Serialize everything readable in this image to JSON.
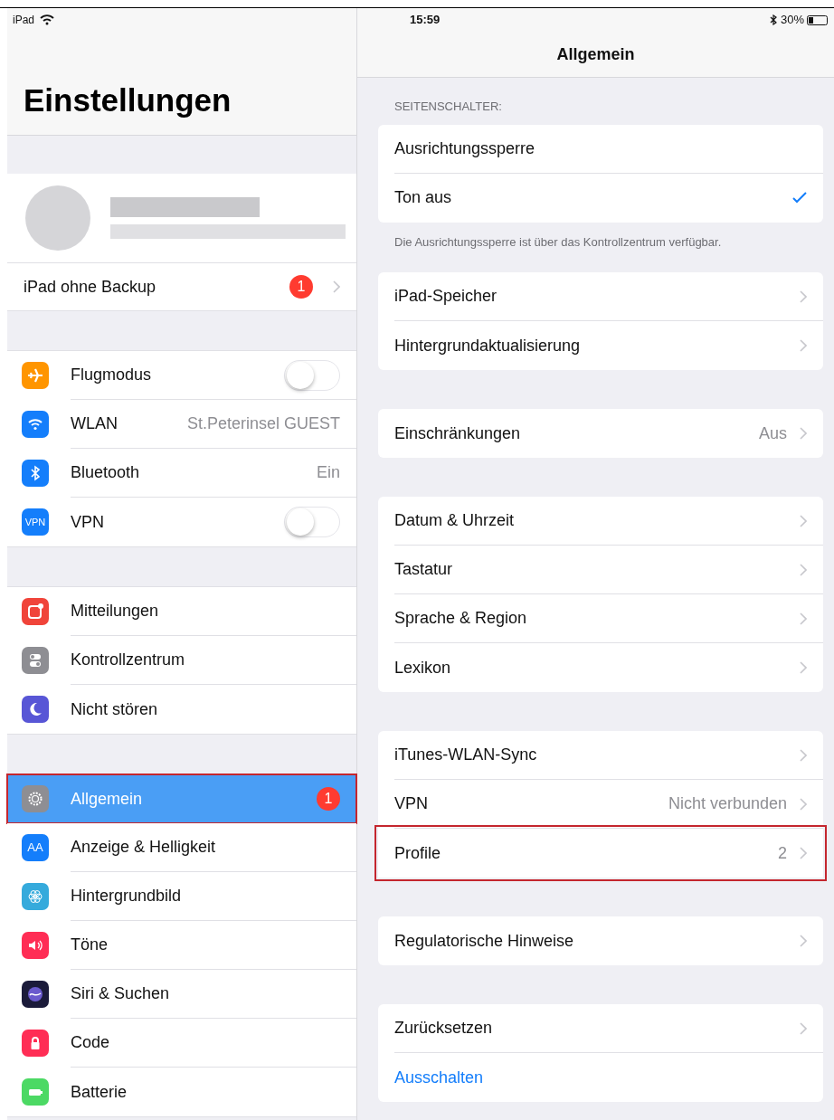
{
  "status_bar": {
    "device": "iPad",
    "time": "15:59",
    "battery": "30%"
  },
  "sidebar": {
    "title": "Einstellungen",
    "backup_row": {
      "label": "iPad ohne Backup",
      "badge": "1"
    },
    "groups": [
      {
        "items": [
          {
            "label": "Flugmodus",
            "kind": "toggle",
            "on": false,
            "selected": false,
            "highlighted": false
          },
          {
            "label": "WLAN",
            "kind": "value",
            "value": "St.Peterinsel GUEST",
            "selected": false,
            "highlighted": false
          },
          {
            "label": "Bluetooth",
            "kind": "value",
            "value": "Ein",
            "selected": false,
            "highlighted": false
          },
          {
            "icon_text": "VPN",
            "label": "VPN",
            "kind": "toggle",
            "on": false,
            "selected": false,
            "highlighted": false
          }
        ]
      },
      {
        "items": [
          {
            "label": "Mitteilungen",
            "kind": "plain",
            "selected": false,
            "highlighted": false
          },
          {
            "label": "Kontrollzentrum",
            "kind": "plain",
            "selected": false,
            "highlighted": false
          },
          {
            "label": "Nicht stören",
            "kind": "plain",
            "selected": false,
            "highlighted": false
          }
        ]
      },
      {
        "items": [
          {
            "label": "Allgemein",
            "kind": "badge",
            "badge": "1",
            "selected": true,
            "highlighted": true
          },
          {
            "icon_text": "AA",
            "label": "Anzeige & Helligkeit",
            "kind": "plain",
            "selected": false,
            "highlighted": false
          },
          {
            "label": "Hintergrundbild",
            "kind": "plain",
            "selected": false,
            "highlighted": false
          },
          {
            "label": "Töne",
            "kind": "plain",
            "selected": false,
            "highlighted": false
          },
          {
            "label": "Siri & Suchen",
            "kind": "plain",
            "selected": false,
            "highlighted": false
          },
          {
            "label": "Code",
            "kind": "plain",
            "selected": false,
            "highlighted": false
          },
          {
            "label": "Batterie",
            "kind": "plain",
            "selected": false,
            "highlighted": false
          }
        ]
      }
    ]
  },
  "detail": {
    "title": "Allgemein",
    "sections": [
      {
        "header": "SEITENSCHALTER:",
        "footer": "Die Ausrichtungssperre ist über das Kontrollzentrum verfügbar.",
        "rows": [
          {
            "label": "Ausrichtungssperre",
            "kind": "check",
            "checked": false,
            "highlighted": false
          },
          {
            "label": "Ton aus",
            "kind": "check",
            "checked": true,
            "highlighted": false
          }
        ]
      },
      {
        "rows": [
          {
            "label": "iPad-Speicher",
            "kind": "nav",
            "highlighted": false
          },
          {
            "label": "Hintergrundaktualisierung",
            "kind": "nav",
            "highlighted": false
          }
        ]
      },
      {
        "rows": [
          {
            "label": "Einschränkungen",
            "kind": "nav",
            "value": "Aus",
            "highlighted": false
          }
        ]
      },
      {
        "rows": [
          {
            "label": "Datum & Uhrzeit",
            "kind": "nav",
            "highlighted": false
          },
          {
            "label": "Tastatur",
            "kind": "nav",
            "highlighted": false
          },
          {
            "label": "Sprache & Region",
            "kind": "nav",
            "highlighted": false
          },
          {
            "label": "Lexikon",
            "kind": "nav",
            "highlighted": false
          }
        ]
      },
      {
        "rows": [
          {
            "label": "iTunes-WLAN-Sync",
            "kind": "nav",
            "highlighted": false
          },
          {
            "label": "VPN",
            "kind": "nav",
            "value": "Nicht verbunden",
            "highlighted": false
          },
          {
            "label": "Profile",
            "kind": "nav",
            "value": "2",
            "highlighted": true
          }
        ]
      },
      {
        "rows": [
          {
            "label": "Regulatorische Hinweise",
            "kind": "nav",
            "highlighted": false
          }
        ]
      },
      {
        "rows": [
          {
            "label": "Zurücksetzen",
            "kind": "nav",
            "highlighted": false
          },
          {
            "label": "Ausschalten",
            "kind": "action",
            "highlighted": false
          }
        ]
      }
    ]
  }
}
